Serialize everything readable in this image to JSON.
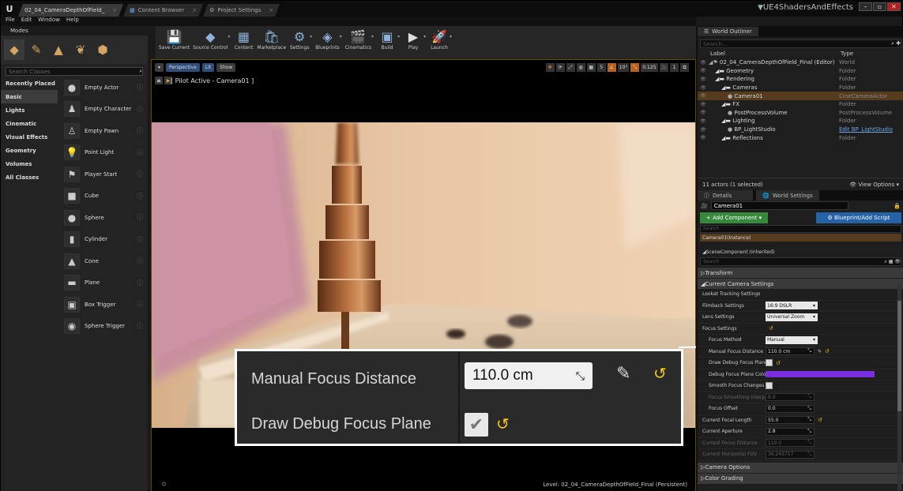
{
  "titlebar": {
    "tabs": [
      {
        "label": "02_04_CameraDepthOfField_"
      },
      {
        "label": "Content Browser"
      },
      {
        "label": "Project Settings"
      }
    ],
    "project_name": "UE4ShadersAndEffects",
    "window_buttons": [
      "–",
      "▫",
      "✕"
    ]
  },
  "menubar": {
    "items": [
      "File",
      "Edit",
      "Window",
      "Help"
    ]
  },
  "modes": {
    "header": "Modes",
    "search_placeholder": "Search Classes",
    "categories": [
      "Recently Placed",
      "Basic",
      "Lights",
      "Cinematic",
      "Visual Effects",
      "Geometry",
      "Volumes",
      "All Classes"
    ],
    "selected_category": "Basic",
    "classes": [
      {
        "label": "Empty Actor",
        "icon": "sphere-icon"
      },
      {
        "label": "Empty Character",
        "icon": "character-icon"
      },
      {
        "label": "Empty Pawn",
        "icon": "pawn-icon"
      },
      {
        "label": "Point Light",
        "icon": "bulb-icon"
      },
      {
        "label": "Player Start",
        "icon": "player-start-icon"
      },
      {
        "label": "Cube",
        "icon": "cube-icon"
      },
      {
        "label": "Sphere",
        "icon": "sphere-icon"
      },
      {
        "label": "Cylinder",
        "icon": "cylinder-icon"
      },
      {
        "label": "Cone",
        "icon": "cone-icon"
      },
      {
        "label": "Plane",
        "icon": "plane-icon"
      },
      {
        "label": "Box Trigger",
        "icon": "box-trigger-icon"
      },
      {
        "label": "Sphere Trigger",
        "icon": "sphere-trigger-icon"
      }
    ]
  },
  "toolbar": {
    "buttons": [
      "Save Current",
      "Source Control",
      "Content",
      "Marketplace",
      "Settings",
      "Blueprints",
      "Cinematics",
      "Build",
      "Play",
      "Launch"
    ]
  },
  "viewport": {
    "perspective": "Perspective",
    "lit": "Lit",
    "show": "Show",
    "pilot": "[ Pilot Active - Camera01 ]",
    "angle": "10°",
    "scale": "0.125",
    "cam_speed": "1",
    "level": "Level:  02_04_CameraDepthOfField_Final (Persistent)"
  },
  "callout": {
    "focus_distance_label": "Manual Focus Distance",
    "focus_distance_value": "110.0 cm",
    "debug_plane_label": "Draw Debug Focus Plane"
  },
  "outliner": {
    "tab": "World Outliner",
    "search_placeholder": "Search...",
    "col_label": "Label",
    "col_type": "Type",
    "rows": [
      {
        "label": "02_04_CameraDepthOfField_Final (Editor)",
        "type": "World",
        "depth": 0
      },
      {
        "label": "Geometry",
        "type": "Folder",
        "depth": 1
      },
      {
        "label": "Rendering",
        "type": "Folder",
        "depth": 1
      },
      {
        "label": "Cameras",
        "type": "Folder",
        "depth": 2
      },
      {
        "label": "Camera01",
        "type": "CineCameraActor",
        "depth": 3,
        "selected": true
      },
      {
        "label": "FX",
        "type": "Folder",
        "depth": 2
      },
      {
        "label": "PostProcessVolume",
        "type": "PostProcessVolume",
        "depth": 3
      },
      {
        "label": "Lighting",
        "type": "Folder",
        "depth": 2
      },
      {
        "label": "BP_LightStudio",
        "type": "Edit BP_LightStudio",
        "depth": 3,
        "link": true
      },
      {
        "label": "Reflections",
        "type": "Folder",
        "depth": 2
      }
    ],
    "actor_count": "11 actors (1 selected)",
    "view_options": "View Options"
  },
  "details": {
    "tabs": [
      "Details",
      "World Settings"
    ],
    "actor_name": "Camera01",
    "add_component": "+ Add Component",
    "blueprint": "Blueprint/Add Script",
    "search_placeholder": "Search",
    "instance": "Camera01(Instance)",
    "scene_component": "SceneComponent (Inherited)",
    "transform": "Transform",
    "section": "Current Camera Settings",
    "props": [
      {
        "label": "Lookat Tracking Settings",
        "value": "",
        "indent": false
      },
      {
        "label": "Filmback Settings",
        "value": "16:9 DSLR",
        "indent": false,
        "dropdown": true
      },
      {
        "label": "Lens Settings",
        "value": "Universal Zoom",
        "indent": false,
        "dropdown": true
      },
      {
        "label": "Focus Settings",
        "value": "",
        "indent": false
      },
      {
        "label": "Focus Method",
        "value": "Manual",
        "indent": true,
        "dropdown": true
      },
      {
        "label": "Manual Focus Distance",
        "value": "110.0 cm",
        "indent": true
      },
      {
        "label": "Draw Debug Focus Plane",
        "value": "",
        "indent": true,
        "check": true
      },
      {
        "label": "Debug Focus Plane Colo",
        "value": "",
        "indent": true,
        "color": "#7a2ee0"
      },
      {
        "label": "Smooth Focus Changes",
        "value": "",
        "indent": true,
        "check": true
      },
      {
        "label": "Focus Smoothing Interp",
        "value": "8.0",
        "indent": true,
        "disabled": true
      },
      {
        "label": "Focus Offset",
        "value": "0.0",
        "indent": true
      },
      {
        "label": "Current Focal Length",
        "value": "55.0",
        "indent": false
      },
      {
        "label": "Current Aperture",
        "value": "2.8",
        "indent": false
      },
      {
        "label": "Current Focus Distance",
        "value": "110.0",
        "indent": false,
        "disabled": true
      },
      {
        "label": "Current Horizontal FOV",
        "value": "36.243717",
        "indent": false,
        "disabled": true
      }
    ],
    "camera_options": "Camera Options",
    "color_grading": "Color Grading"
  }
}
